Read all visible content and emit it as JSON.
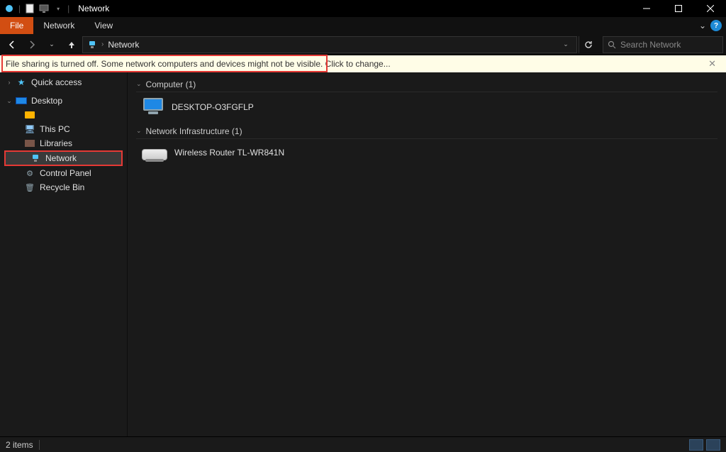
{
  "titlebar": {
    "title": "Network"
  },
  "ribbon": {
    "file": "File",
    "tabs": [
      "Network",
      "View"
    ]
  },
  "address": {
    "location": "Network",
    "search_placeholder": "Search Network"
  },
  "infobar": {
    "message": "File sharing is turned off. Some network computers and devices might not be visible. Click to change..."
  },
  "nav": {
    "quick_access": "Quick access",
    "desktop": "Desktop",
    "unnamed_folder": "",
    "this_pc": "This PC",
    "libraries": "Libraries",
    "network": "Network",
    "control_panel": "Control Panel",
    "recycle_bin": "Recycle Bin"
  },
  "content": {
    "group_computer": {
      "label": "Computer (1)",
      "items": [
        "DESKTOP-O3FGFLP"
      ]
    },
    "group_netinfra": {
      "label": "Network Infrastructure (1)",
      "items": [
        "Wireless Router TL-WR841N"
      ]
    }
  },
  "status": {
    "items": "2 items"
  }
}
